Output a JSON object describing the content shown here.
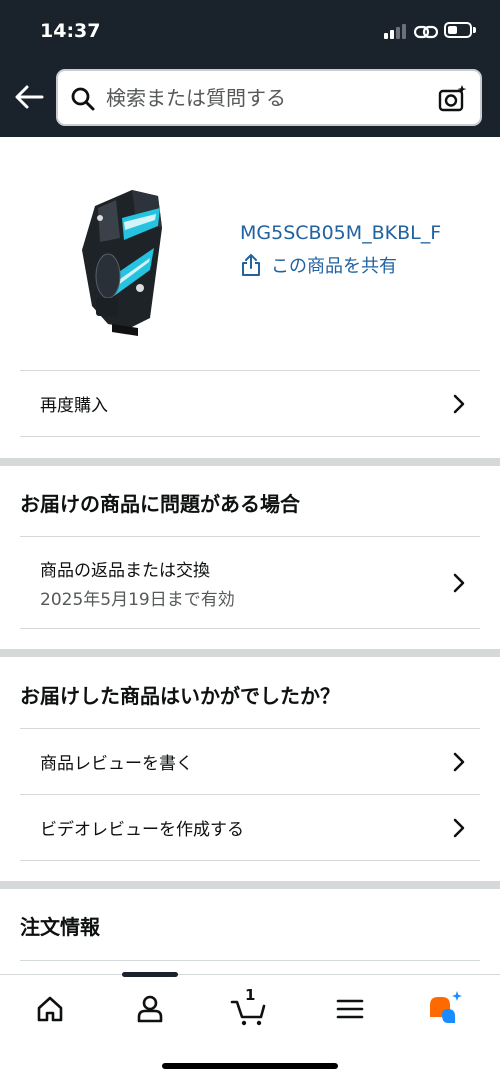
{
  "status_bar": {
    "time": "14:37"
  },
  "search": {
    "placeholder": "検索または質問する"
  },
  "product": {
    "asin": "MG5SCB05M_BKBL_F",
    "share_label": "この商品を共有"
  },
  "buy_again": {
    "label": "再度購入"
  },
  "problem_section": {
    "title": "お届けの商品に問題がある場合",
    "return_label": "商品の返品または交換",
    "return_deadline": "2025年5月19日まで有効"
  },
  "review_section": {
    "title": "お届けした商品はいかがでしたか？",
    "write_review": "商品レビューを書く",
    "video_review": "ビデオレビューを作成する"
  },
  "order_section": {
    "title": "注文情報"
  },
  "tabbar": {
    "cart_count": "1",
    "icons": [
      "home-icon",
      "account-icon",
      "cart-icon",
      "menu-icon",
      "rufus-icon"
    ]
  },
  "colors": {
    "header_bg": "#1a222b",
    "link": "#2162a1",
    "divider": "#d5d9d9",
    "accent_orange": "#ff6a00",
    "accent_blue": "#1a8cff"
  }
}
